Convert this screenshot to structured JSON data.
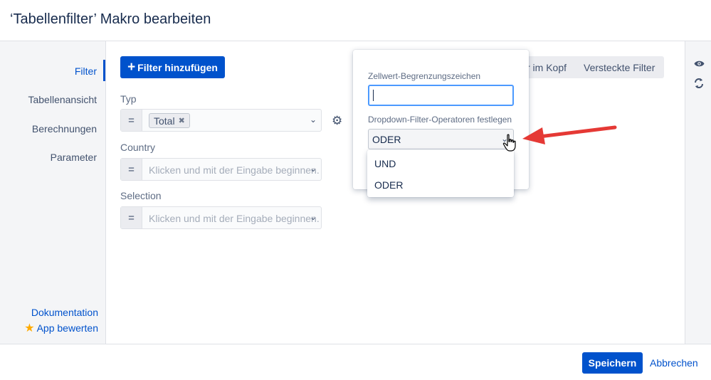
{
  "dialog": {
    "title": "‘Tabellenfilter’ Makro bearbeiten"
  },
  "sidebar": {
    "items": [
      {
        "label": "Filter",
        "active": true
      },
      {
        "label": "Tabellenansicht"
      },
      {
        "label": "Berechnungen"
      },
      {
        "label": "Parameter"
      }
    ],
    "footer": {
      "documentation_label": "Dokumentation",
      "rate_app_label": "App bewerten",
      "rate_app_icon": "star-icon"
    }
  },
  "toolbar": {
    "add_filter_label": "Filter hinzufügen",
    "tabs": [
      {
        "label": "r im Kopf"
      },
      {
        "label": "Versteckte Filter"
      }
    ]
  },
  "filters": [
    {
      "label": "Typ",
      "operator": "=",
      "tags": [
        "Total"
      ]
    },
    {
      "label": "Country",
      "operator": "=",
      "placeholder": "Klicken und mit der Eingabe beginnen."
    },
    {
      "label": "Selection",
      "operator": "=",
      "placeholder": "Klicken und mit der Eingabe beginnen."
    }
  ],
  "settings_popover": {
    "delimiter_label": "Zellwert-Begrenzungszeichen",
    "delimiter_value": "",
    "operator_label": "Dropdown-Filter-Operatoren festlegen",
    "operator_selected": "ODER",
    "operator_options": [
      "UND",
      "ODER"
    ]
  },
  "right_bar": {
    "icons": [
      "eye-icon",
      "refresh-icon"
    ]
  },
  "footer": {
    "save_label": "Speichern",
    "cancel_label": "Abbrechen"
  },
  "colors": {
    "primary": "#0052cc",
    "annotation_arrow": "#e53935",
    "star": "#ffab00"
  }
}
